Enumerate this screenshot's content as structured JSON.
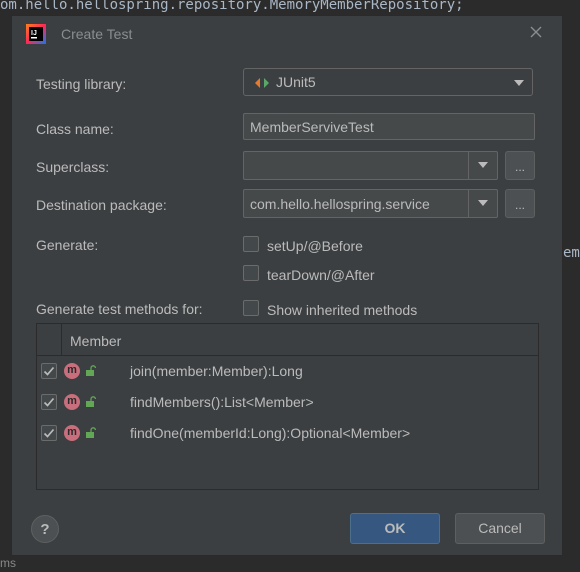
{
  "background": {
    "top_code": "om.hello.hellospring.repository.MemoryMemberRepository;",
    "right_fragment": "em",
    "bottom_text": "ms"
  },
  "dialog": {
    "title": "Create Test",
    "testing_library_label": "Testing library:",
    "testing_library_value": "JUnit5",
    "class_name_label": "Class name:",
    "class_name_value": "MemberServiveTest",
    "superclass_label": "Superclass:",
    "superclass_value": "",
    "destination_label": "Destination package:",
    "destination_value": "com.hello.hellospring.service",
    "ellipsis": "...",
    "generate_label": "Generate:",
    "setup_label": "setUp/@Before",
    "teardown_label": "tearDown/@After",
    "generate_methods_label": "Generate test methods for:",
    "show_inherited_label": "Show inherited methods",
    "table_header": "Member",
    "methods": [
      {
        "name": "join(member:Member):Long",
        "checked": true
      },
      {
        "name": "findMembers():List<Member>",
        "checked": true
      },
      {
        "name": "findOne(memberId:Long):Optional<Member>",
        "checked": true
      }
    ],
    "method_badge": "m",
    "help": "?",
    "ok": "OK",
    "cancel": "Cancel"
  },
  "colors": {
    "dialog_bg": "#3c3f41",
    "ok_bg": "#365880",
    "method_badge": "#c96e7c"
  }
}
